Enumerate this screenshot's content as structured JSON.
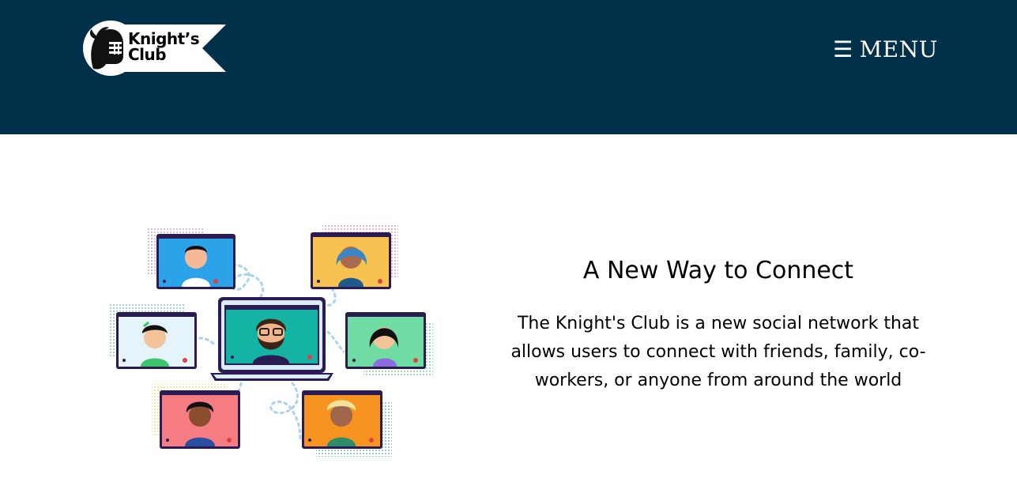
{
  "header": {
    "logo": {
      "line1": "Knight’s",
      "line2": "Club",
      "icon": "knight-helmet-icon"
    },
    "menu": {
      "icon": "hamburger-menu-icon",
      "icon_glyph": "☰",
      "label": "MENU"
    }
  },
  "hero": {
    "illustration": {
      "icon": "video-conference-illustration"
    },
    "title": "A New Way to Connect",
    "description": "The Knight's Club is a new social network that allows users to connect with friends, family, co-workers, or anyone from around the world"
  },
  "colors": {
    "header_bg": "#01304b",
    "page_bg": "#ffffff",
    "text": "#000000",
    "menu_text": "#ffffff"
  }
}
